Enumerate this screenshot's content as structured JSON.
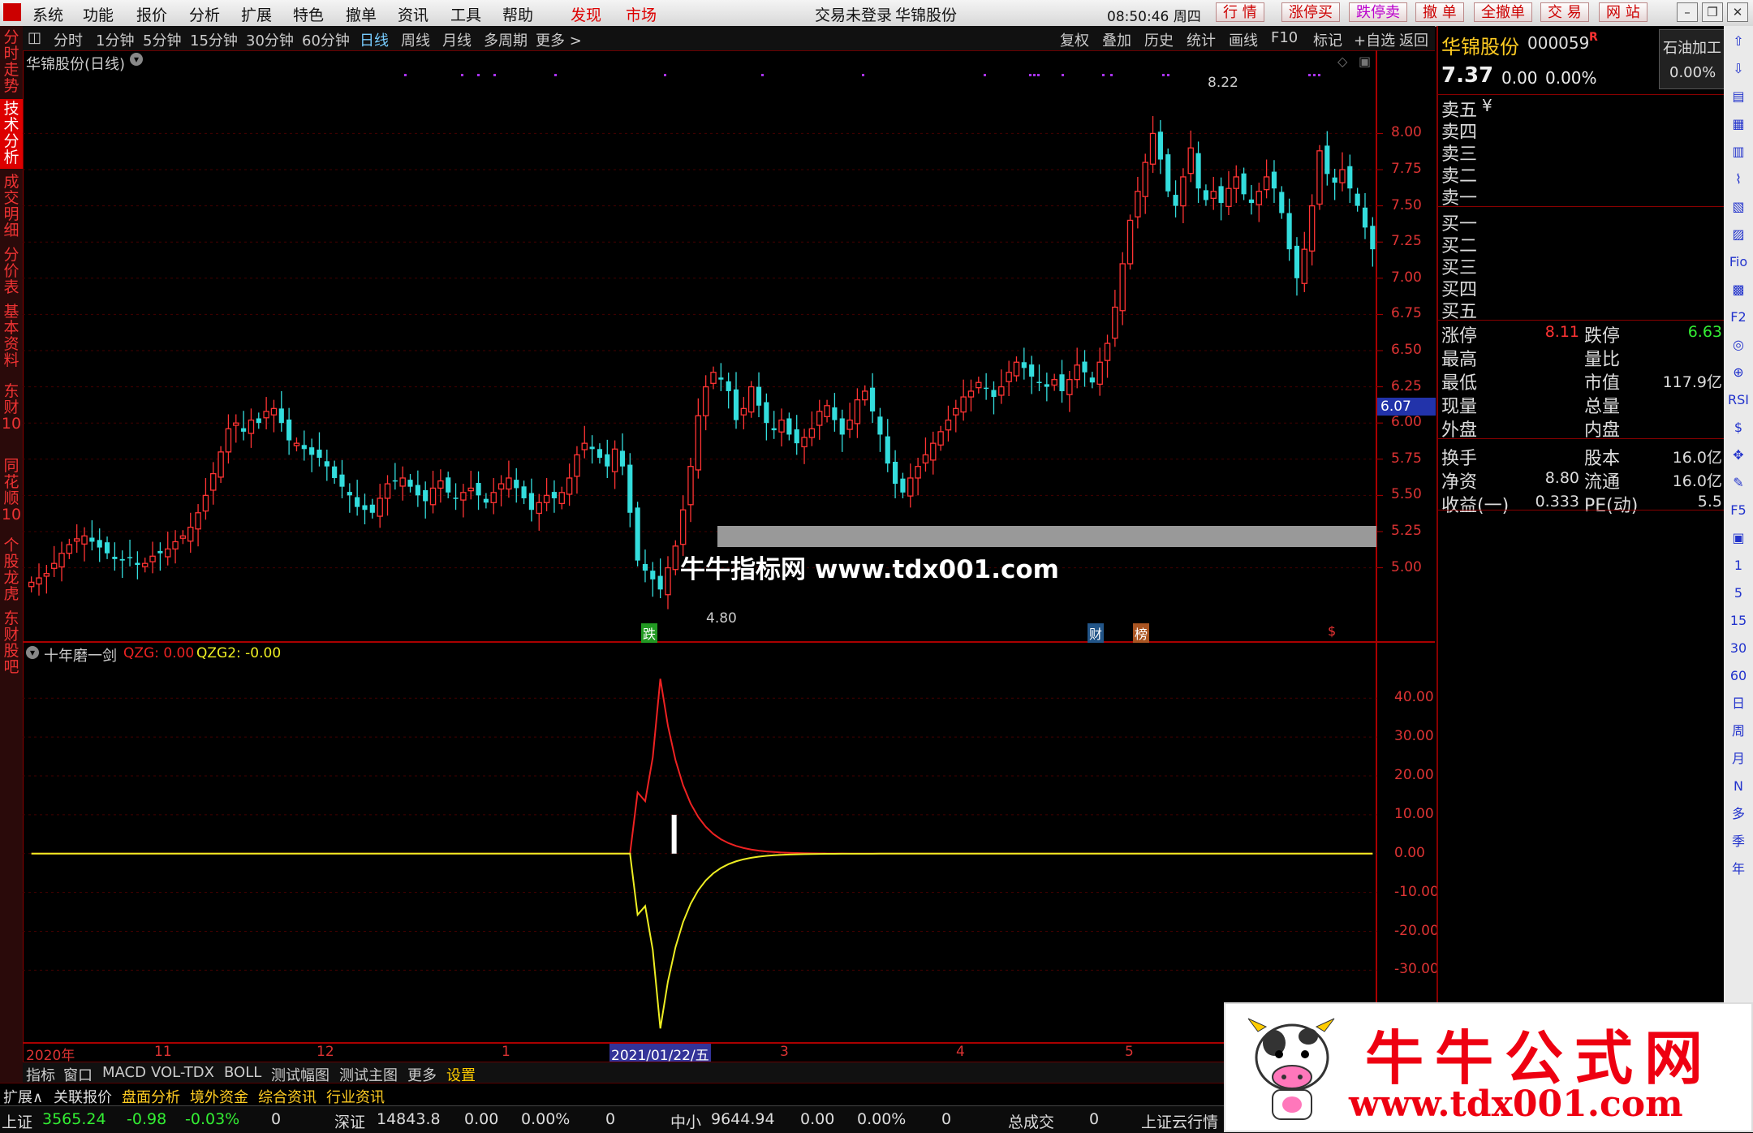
{
  "menubar": {
    "items": [
      "系统",
      "功能",
      "报价",
      "分析",
      "扩展",
      "特色",
      "撤单",
      "资讯",
      "工具",
      "帮助"
    ],
    "discover": "发现",
    "market": "市场",
    "login_status": "交易未登录",
    "stock_name": "华锦股份",
    "time": "08:50:46 周四",
    "right_buttons": [
      "行 情",
      "涨停买",
      "跌停卖",
      "撤 单",
      "全撤单",
      "交 易",
      "网 站"
    ]
  },
  "left_tabs": [
    "分时走势",
    "技术分析",
    "成交明细",
    "分价表",
    "基本资料",
    "东财10",
    "同花顺10",
    "个股龙虎",
    "东财股吧"
  ],
  "period_toolbar": {
    "periods": [
      "分时",
      "1分钟",
      "5分钟",
      "15分钟",
      "30分钟",
      "60分钟",
      "日线",
      "周线",
      "月线",
      "多周期",
      "更多 >"
    ],
    "selected": "日线",
    "tools": [
      "复权",
      "叠加",
      "历史",
      "统计",
      "画线",
      "F10",
      "标记",
      "+自选",
      "返回"
    ]
  },
  "main_chart": {
    "title": "华锦股份(日线)",
    "price_label": "6.07",
    "high_label": "8.22",
    "low_label": "4.80",
    "watermark": "牛牛指标网 www.tdx001.com",
    "markers": [
      {
        "text": "跌",
        "color": "#2c2"
      },
      {
        "text": "财",
        "color": "#6af"
      },
      {
        "text": "榜",
        "color": "#f93"
      },
      {
        "text": "$",
        "color": "#e33"
      }
    ]
  },
  "sub_chart": {
    "name": "十年磨一剑",
    "qzg_label": "QZG: 0.00",
    "qzg2_label": "QZG2: -0.00"
  },
  "chart_data": [
    {
      "type": "candlestick",
      "title": "华锦股份(日线)",
      "y_ticks": [
        5.0,
        5.25,
        5.5,
        5.75,
        6.0,
        6.25,
        6.5,
        6.75,
        7.0,
        7.25,
        7.5,
        7.75,
        8.0
      ],
      "y_range": [
        4.65,
        8.35
      ],
      "x_labels": [
        "2020年",
        "11",
        "12",
        "1",
        "2021/01/22/五",
        "3",
        "4",
        "5"
      ],
      "highest": 8.22,
      "lowest": 4.8,
      "closes": [
        4.9,
        4.93,
        4.96,
        5.03,
        5.1,
        5.16,
        5.2,
        5.22,
        5.18,
        5.14,
        5.1,
        5.06,
        5.05,
        5.07,
        5.02,
        5.03,
        5.08,
        5.1,
        5.13,
        5.18,
        5.22,
        5.28,
        5.38,
        5.5,
        5.65,
        5.8,
        5.96,
        6.0,
        5.94,
        6.02,
        6.0,
        6.08,
        6.1,
        6.0,
        5.88,
        5.86,
        5.82,
        5.78,
        5.76,
        5.7,
        5.62,
        5.56,
        5.5,
        5.42,
        5.4,
        5.38,
        5.48,
        5.58,
        5.6,
        5.62,
        5.56,
        5.5,
        5.46,
        5.55,
        5.6,
        5.52,
        5.48,
        5.52,
        5.55,
        5.5,
        5.45,
        5.52,
        5.58,
        5.62,
        5.55,
        5.48,
        5.4,
        5.45,
        5.5,
        5.48,
        5.52,
        5.62,
        5.78,
        5.86,
        5.82,
        5.76,
        5.7,
        5.82,
        5.7,
        5.38,
        5.05,
        4.98,
        4.92,
        4.85,
        5.0,
        5.15,
        5.4,
        5.7,
        6.05,
        6.25,
        6.35,
        6.3,
        6.22,
        6.02,
        6.1,
        6.25,
        6.12,
        6.0,
        5.95,
        6.02,
        5.92,
        5.86,
        5.9,
        5.96,
        6.08,
        6.12,
        6.02,
        5.92,
        6.02,
        6.16,
        6.22,
        6.08,
        5.92,
        5.72,
        5.58,
        5.52,
        5.62,
        5.7,
        5.78,
        5.86,
        5.94,
        6.02,
        6.1,
        6.18,
        6.22,
        6.28,
        6.24,
        6.18,
        6.25,
        6.35,
        6.42,
        6.38,
        6.32,
        6.28,
        6.25,
        6.3,
        6.22,
        6.3,
        6.4,
        6.35,
        6.28,
        6.42,
        6.55,
        6.8,
        7.1,
        7.4,
        7.6,
        7.8,
        8.0,
        7.82,
        7.6,
        7.5,
        7.7,
        7.9,
        7.62,
        7.54,
        7.6,
        7.52,
        7.62,
        7.7,
        7.58,
        7.52,
        7.6,
        7.7,
        7.62,
        7.45,
        7.2,
        7.0,
        7.2,
        7.5,
        7.88,
        7.72,
        7.66,
        7.75,
        7.62,
        7.5,
        7.35,
        7.2
      ]
    },
    {
      "type": "line",
      "title": "十年磨一剑",
      "y_ticks": [
        40,
        30,
        20,
        10,
        0,
        -10,
        -20,
        -30
      ],
      "y_range": [
        -46,
        48
      ],
      "series": [
        {
          "name": "QZG",
          "color": "#e22",
          "peak": 45,
          "peak_index": 83
        },
        {
          "name": "QZG2",
          "color": "#ee2",
          "trough": -45,
          "trough_index": 83
        }
      ]
    }
  ],
  "right_panel": {
    "stock_name": "华锦股份",
    "code": "000059",
    "code_tag": "R",
    "industry": "石油加工",
    "industry_pct": "0.00%",
    "price": "7.37",
    "change": "0.00",
    "pct": "0.00%",
    "sell_rows": [
      "卖五",
      "卖四",
      "卖三",
      "卖二",
      "卖一"
    ],
    "yen": "¥",
    "buy_rows": [
      "买一",
      "买二",
      "买三",
      "买四",
      "买五"
    ],
    "stats": [
      {
        "l": "涨停",
        "v": "8.11",
        "v_color": "#f33",
        "l2": "跌停",
        "v2": "6.63",
        "v2_color": "#3e3"
      },
      {
        "l": "最高",
        "v": "",
        "l2": "量比",
        "v2": ""
      },
      {
        "l": "最低",
        "v": "",
        "l2": "市值",
        "v2": "117.9亿"
      },
      {
        "l": "现量",
        "v": "",
        "l2": "总量",
        "v2": ""
      },
      {
        "l": "外盘",
        "v": "",
        "l2": "内盘",
        "v2": ""
      },
      {
        "l": "换手",
        "v": "",
        "l2": "股本",
        "v2": "16.0亿"
      },
      {
        "l": "净资",
        "v": "8.80",
        "l2": "流通",
        "v2": "16.0亿"
      },
      {
        "l": "收益(一)",
        "v": "0.333",
        "l2": "PE(动)",
        "v2": "5.5"
      }
    ]
  },
  "right_tools": [
    "⇧",
    "⇩",
    "▤",
    "▦",
    "▥",
    "⌇",
    "▧",
    "▨",
    "Fio",
    "▩",
    "F2",
    "◎",
    "⊕",
    "RSI",
    "$",
    "✥",
    "✎",
    "F5",
    "▣",
    "1",
    "5",
    "15",
    "30",
    "60",
    "日",
    "周",
    "月",
    "N",
    "多",
    "季",
    "年"
  ],
  "bottom_tabs": [
    "指标",
    "窗口",
    "MACD",
    "VOL-TDX",
    "BOLL",
    "测试幅图",
    "测试主图",
    "更多",
    "设置"
  ],
  "ext_bar": [
    "扩展∧",
    "关联报价",
    "盘面分析",
    "境外资金",
    "综合资讯",
    "行业资讯"
  ],
  "status_bar": {
    "sh_label": "上证",
    "sh_val": "3565.24",
    "sh_chg": "-0.98",
    "sh_pct": "-0.03%",
    "sh_vol": "0",
    "sz_label": "深证",
    "sz_val": "14843.8",
    "sz_chg": "0.00",
    "sz_pct": "0.00%",
    "sz_vol": "0",
    "zx_label": "中小",
    "zx_val": "9644.94",
    "zx_chg": "0.00",
    "zx_pct": "0.00%",
    "zx_vol": "0",
    "total_label": "总成交",
    "total_val": "0",
    "cloud": "上证云行情"
  },
  "banner": {
    "title": "牛牛公式网",
    "url": "www.tdx001.com"
  }
}
